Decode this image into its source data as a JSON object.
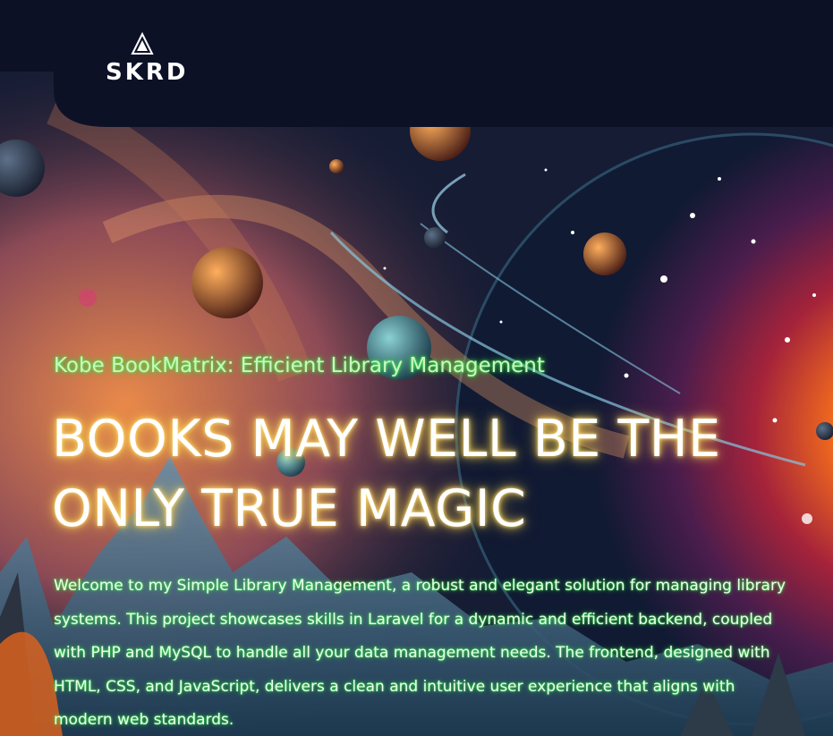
{
  "header": {
    "logo_text": "SKRD",
    "logo_icon": "mountain-triangle-icon"
  },
  "hero": {
    "subtitle": "Kobe BookMatrix: Efficient Library Management",
    "headline": "BOOKS MAY WELL BE THE ONLY TRUE MAGIC",
    "description": "Welcome to my Simple Library Management, a robust and elegant solution for managing library systems. This project showcases skills in Laravel for a dynamic and efficient backend, coupled with PHP and MySQL to handle all your data management needs. The frontend, designed with HTML, CSS, and JavaScript, delivers a clean and intuitive user experience that aligns with modern web standards.",
    "background_image": "space-fantasy-planets-illustration"
  },
  "colors": {
    "header_bg": "#0d1126",
    "subtitle_glow": "#3cff4a",
    "headline_glow": "#ffd24a"
  }
}
